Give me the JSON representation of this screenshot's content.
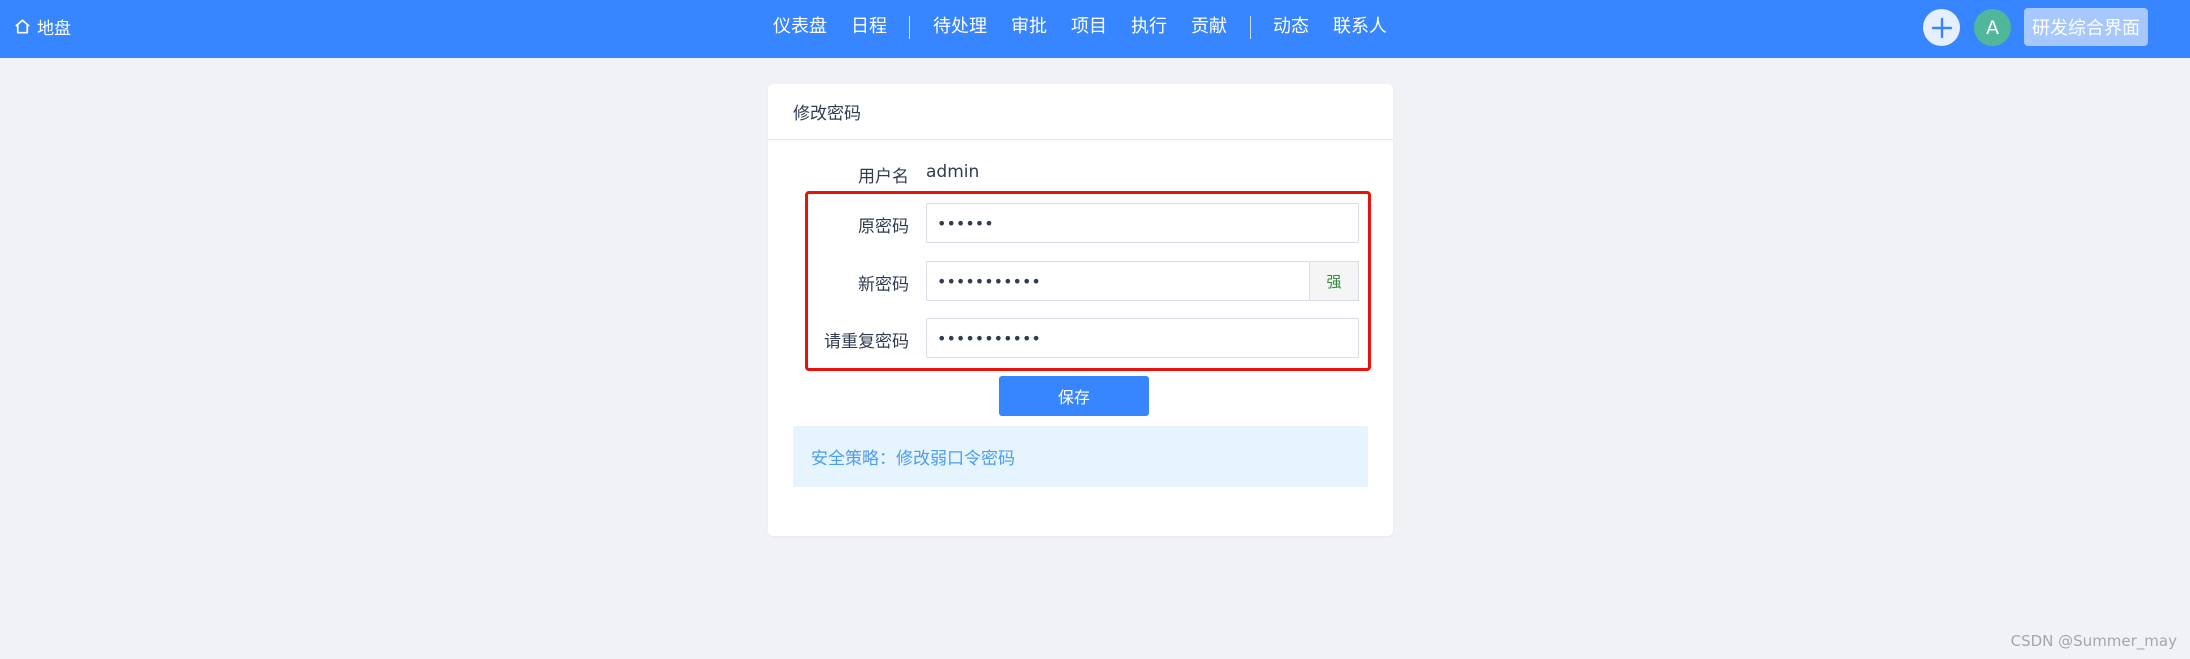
{
  "topbar": {
    "brand": "地盘",
    "nav": [
      "仪表盘",
      "日程",
      "待处理",
      "审批",
      "项目",
      "执行",
      "贡献",
      "动态",
      "联系人"
    ],
    "avatar_letter": "A",
    "switch_label": "研发综合界面",
    "bg_color": "#3785ff"
  },
  "card": {
    "title": "修改密码",
    "username_label": "用户名",
    "username_value": "admin",
    "old_password_label": "原密码",
    "old_password_value": "••••••",
    "new_password_label": "新密码",
    "new_password_value": "•••••••••••",
    "strength_label": "强",
    "repeat_password_label": "请重复密码",
    "repeat_password_value": "•••••••••••",
    "save_label": "保存",
    "notice": "安全策略：修改弱口令密码"
  },
  "watermark": "CSDN @Summer_may"
}
